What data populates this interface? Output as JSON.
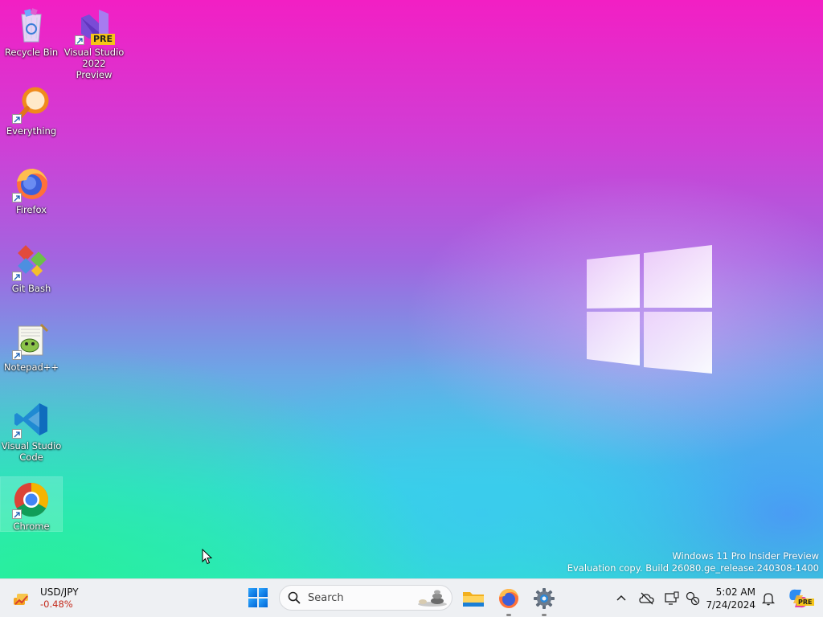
{
  "desktop": {
    "icons": [
      {
        "label": "Recycle Bin",
        "icon": "recycle-bin-icon"
      },
      {
        "label": "Visual Studio 2022 Preview",
        "icon": "visual-studio-preview-icon",
        "badge": "PRE"
      },
      {
        "label": "Everything",
        "icon": "everything-search-icon"
      },
      {
        "label": "Firefox",
        "icon": "firefox-icon"
      },
      {
        "label": "Git Bash",
        "icon": "git-bash-icon"
      },
      {
        "label": "Notepad++",
        "icon": "notepad-plus-plus-icon"
      },
      {
        "label": "Visual Studio Code",
        "icon": "vscode-icon"
      },
      {
        "label": "Chrome",
        "icon": "chrome-icon",
        "selected": true
      }
    ],
    "watermark": {
      "line1": "Windows 11 Pro Insider Preview",
      "line2": "Evaluation copy. Build 26080.ge_release.240308-1400"
    }
  },
  "taskbar": {
    "widget": {
      "pair": "USD/JPY",
      "change": "-0.48%",
      "change_color": "#c42b1c"
    },
    "search": {
      "placeholder": "Search"
    },
    "apps": [
      {
        "name": "file-explorer",
        "icon": "folder-icon",
        "running": false
      },
      {
        "name": "firefox",
        "icon": "firefox-icon",
        "running": true
      },
      {
        "name": "settings",
        "icon": "gear-icon",
        "running": true
      }
    ],
    "tray": {
      "icons": [
        "chevron-up-icon",
        "onedrive-offline-icon",
        "display-icon",
        "network-icon",
        "notification-bell-icon",
        "copilot-icon"
      ],
      "copilot_badge": "PRE"
    },
    "clock": {
      "time": "5:02 AM",
      "date": "7/24/2024"
    }
  },
  "colors": {
    "accent": "#0078d4",
    "taskbar_bg": "#eef0f3"
  }
}
